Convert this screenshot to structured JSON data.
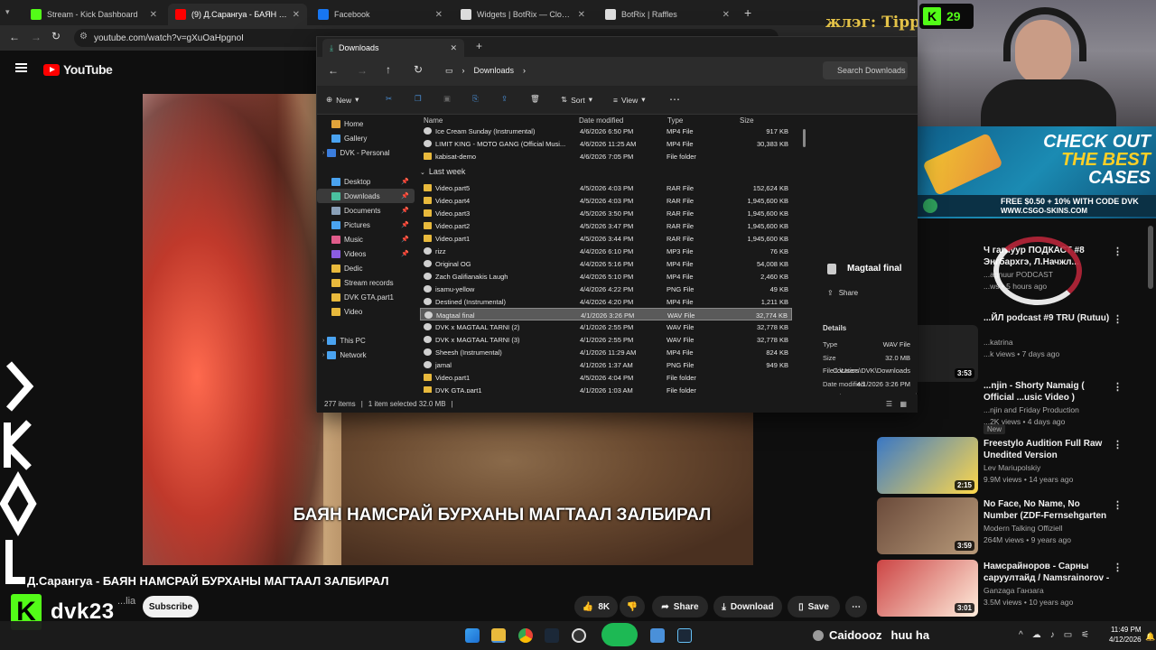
{
  "browser": {
    "tabs": [
      {
        "label": "Stream - Kick Dashboard",
        "fav_color": "#53fc18"
      },
      {
        "label": "(9) Д.Сарангуа - БАЯН НАМСРАЙ",
        "fav_color": "#ff0000"
      },
      {
        "label": "Facebook",
        "fav_color": "#1877f2"
      },
      {
        "label": "Widgets | BotRix — Cloud Stre...",
        "fav_color": "#dddddd"
      },
      {
        "label": "BotRix | Raffles",
        "fav_color": "#dddddd"
      }
    ],
    "new_tab": "+",
    "url": "youtube.com/watch?v=gXuOaHpgnoI"
  },
  "youtube": {
    "logo_text": "YouTube",
    "video_subtitle": "БАЯН НАМСРАЙ БУРХАНЫ МАГТААЛ ЗАЛБИРАЛ",
    "overlay_text": "жлэг: Tipp",
    "title": "Д.Сарангуа - БАЯН НАМСРАЙ БУРХАНЫ МАГТААЛ ЗАЛБИРАЛ",
    "channel": "...lia",
    "subscribe": "Subscribe",
    "likes": "8K",
    "share": "Share",
    "download": "Download",
    "save": "Save",
    "recommendations": [
      {
        "title": "Ч гагнуур ПОДКАСТ #8 Энгбархгэ, Л.Начжл...",
        "meta1": "...agnuur PODCAST",
        "meta2": "...ws • 5 hours ago",
        "duration": ""
      },
      {
        "title": "...ЙЛ podcast #9 TRU (Rutuu)",
        "meta1": "...katrina",
        "meta2": "...k views • 7 days ago",
        "duration": ""
      },
      {
        "title": "...njin - Shorty Namaig ( Official ...usic Video )",
        "meta1": "...njin and Friday Production",
        "meta2": "...2K views • 4 days ago",
        "duration": "3:53",
        "badge": "New"
      },
      {
        "title": "Freestylo Audition Full Raw Unedited Version",
        "meta1": "Lev Mariupolskiy",
        "meta2": "9.9M views • 14 years ago",
        "duration": "2:15"
      },
      {
        "title": "No Face, No Name, No Number (ZDF-Fernsehgarten 4.6.2000)...",
        "meta1": "Modern Talking Offiziell",
        "meta2": "264M views • 9 years ago",
        "duration": "3:59"
      },
      {
        "title": "Намсрайноров - Сарны саруултайд / Namsrainorov - ...",
        "meta1": "Ganzaga Ганзага",
        "meta2": "3.5M views • 10 years ago",
        "duration": "3:01"
      }
    ]
  },
  "kick": {
    "name": "dvk23",
    "badge": "K",
    "viewer_count": "29"
  },
  "ad": {
    "line1": "CHECK OUT",
    "line2": "THE BEST",
    "line3": "CASES",
    "promo": "FREE $0.50 + 10% WITH CODE DVK",
    "site": "WWW.CSGO-SKINS.COM"
  },
  "explorer": {
    "tab_title": "Downloads",
    "breadcrumb": "Downloads",
    "search_placeholder": "Search Downloads",
    "commands": {
      "new": "New",
      "sort": "Sort",
      "view": "View"
    },
    "nav": [
      {
        "label": "Home",
        "color": "#e0a33a",
        "pin": false
      },
      {
        "label": "Gallery",
        "color": "#4aa3f0",
        "pin": false
      },
      {
        "label": "DVK - Personal",
        "color": "#3b7ddd",
        "pin": false,
        "expand": true
      },
      {
        "label": "Desktop",
        "color": "#4aa3f0",
        "pin": true
      },
      {
        "label": "Downloads",
        "color": "#4ac0a0",
        "pin": true,
        "selected": true
      },
      {
        "label": "Documents",
        "color": "#8aa0b8",
        "pin": true
      },
      {
        "label": "Pictures",
        "color": "#4aa3f0",
        "pin": true
      },
      {
        "label": "Music",
        "color": "#e05c8a",
        "pin": true
      },
      {
        "label": "Videos",
        "color": "#8a5ce0",
        "pin": true
      },
      {
        "label": "Dedic",
        "color": "#e8b93c",
        "pin": false
      },
      {
        "label": "Stream records",
        "color": "#e8b93c",
        "pin": false
      },
      {
        "label": "DVK GTA.part1",
        "color": "#e8b93c",
        "pin": false
      },
      {
        "label": "Video",
        "color": "#e8b93c",
        "pin": false
      },
      {
        "label": "This PC",
        "color": "#4aa3f0",
        "pin": false,
        "expand": true
      },
      {
        "label": "Network",
        "color": "#4aa3f0",
        "pin": false,
        "expand": true
      }
    ],
    "columns": {
      "name": "Name",
      "date": "Date modified",
      "type": "Type",
      "size": "Size"
    },
    "top_files": [
      {
        "name": "Ice Cream Sunday (Instrumental)",
        "date": "4/6/2026 6:50 PM",
        "type": "MP4 File",
        "size": "917 KB",
        "kind": "file"
      },
      {
        "name": "LIMIT KING - MOTO GANG (Official Musi...",
        "date": "4/6/2026 11:25 AM",
        "type": "MP4 File",
        "size": "30,383 KB",
        "kind": "file"
      },
      {
        "name": "kabisat-demo",
        "date": "4/6/2026 7:05 PM",
        "type": "File folder",
        "size": "",
        "kind": "folder"
      }
    ],
    "group_label": "Last week",
    "files": [
      {
        "name": "Video.part5",
        "date": "4/5/2026 4:03 PM",
        "type": "RAR File",
        "size": "152,624 KB",
        "kind": "folder"
      },
      {
        "name": "Video.part4",
        "date": "4/5/2026 4:03 PM",
        "type": "RAR File",
        "size": "1,945,600 KB",
        "kind": "folder"
      },
      {
        "name": "Video.part3",
        "date": "4/5/2026 3:50 PM",
        "type": "RAR File",
        "size": "1,945,600 KB",
        "kind": "folder"
      },
      {
        "name": "Video.part2",
        "date": "4/5/2026 3:47 PM",
        "type": "RAR File",
        "size": "1,945,600 KB",
        "kind": "folder"
      },
      {
        "name": "Video.part1",
        "date": "4/5/2026 3:44 PM",
        "type": "RAR File",
        "size": "1,945,600 KB",
        "kind": "folder"
      },
      {
        "name": "rizz",
        "date": "4/4/2026 6:10 PM",
        "type": "MP3 File",
        "size": "76 KB",
        "kind": "file"
      },
      {
        "name": "Original OG",
        "date": "4/4/2026 5:16 PM",
        "type": "MP4 File",
        "size": "54,008 KB",
        "kind": "file"
      },
      {
        "name": "Zach Galifianakis Laugh",
        "date": "4/4/2026 5:10 PM",
        "type": "MP4 File",
        "size": "2,460 KB",
        "kind": "file"
      },
      {
        "name": "isamu-yellow",
        "date": "4/4/2026 4:22 PM",
        "type": "PNG File",
        "size": "49 KB",
        "kind": "file"
      },
      {
        "name": "Destined (Instrumental)",
        "date": "4/4/2026 4:20 PM",
        "type": "MP4 File",
        "size": "1,211 KB",
        "kind": "file"
      },
      {
        "name": "Magtaal final",
        "date": "4/1/2026 3:26 PM",
        "type": "WAV File",
        "size": "32,774 KB",
        "kind": "file",
        "selected": true
      },
      {
        "name": "DVK x MAGTAAL TARNI (2)",
        "date": "4/1/2026 2:55 PM",
        "type": "WAV File",
        "size": "32,778 KB",
        "kind": "file"
      },
      {
        "name": "DVK x MAGTAAL TARNI (3)",
        "date": "4/1/2026 2:55 PM",
        "type": "WAV File",
        "size": "32,778 KB",
        "kind": "file"
      },
      {
        "name": "Sheesh (Instrumental)",
        "date": "4/1/2026 11:29 AM",
        "type": "MP4 File",
        "size": "824 KB",
        "kind": "file"
      },
      {
        "name": "jamal",
        "date": "4/1/2026 1:37 AM",
        "type": "PNG File",
        "size": "949 KB",
        "kind": "file"
      },
      {
        "name": "Video.part1",
        "date": "4/5/2026 4:04 PM",
        "type": "File folder",
        "size": "",
        "kind": "folder"
      },
      {
        "name": "DVK GTA.part1",
        "date": "4/1/2026 1:03 AM",
        "type": "File folder",
        "size": "",
        "kind": "folder"
      }
    ],
    "details": {
      "title": "Magtaal final",
      "share": "Share",
      "section": "Details",
      "props": [
        {
          "k": "Type",
          "v": "WAV File"
        },
        {
          "k": "Size",
          "v": "32.0 MB"
        },
        {
          "k": "File location",
          "v": "C:\\Users\\DVK\\Downloads"
        },
        {
          "k": "Date modified",
          "v": "4/1/2026 3:26 PM"
        },
        {
          "k": "Length",
          "v": ""
        }
      ]
    },
    "status": {
      "count": "277 items",
      "selected": "1 item selected  32.0 MB"
    }
  },
  "taskbar": {
    "chat_user": "Caidoooz",
    "chat_text": "huu ha",
    "time": "11:49 PM",
    "date": "4/12/2026"
  }
}
